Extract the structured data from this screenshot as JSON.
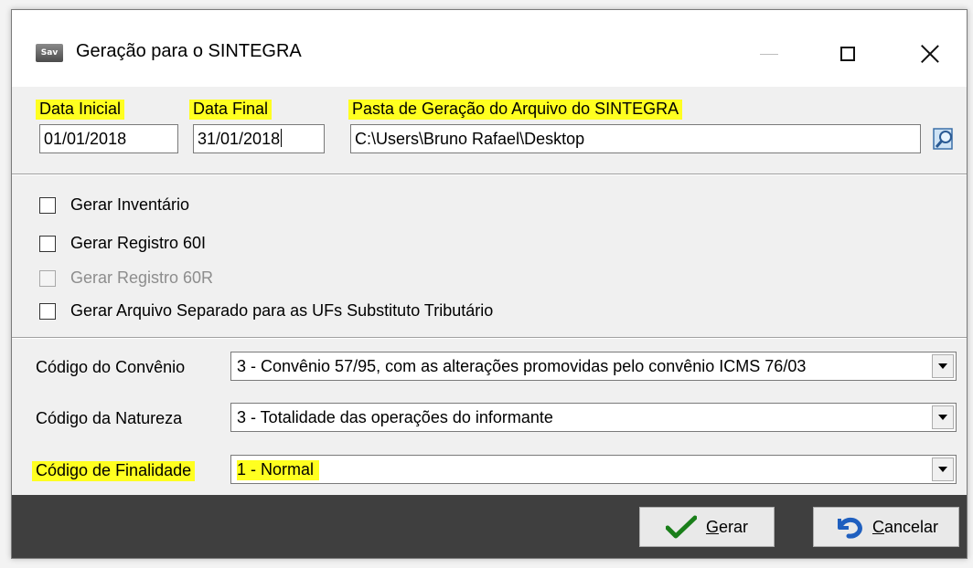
{
  "window": {
    "title": "Geração para o SINTEGRA",
    "icon_text": "Sav"
  },
  "dates": {
    "data_inicial_label": "Data Inicial",
    "data_inicial_value": "01/01/2018",
    "data_final_label": "Data Final",
    "data_final_value": "31/01/2018"
  },
  "folder": {
    "label": "Pasta de Geração do Arquivo do SINTEGRA",
    "value": "C:\\Users\\Bruno Rafael\\Desktop"
  },
  "options": [
    {
      "label": "Gerar Inventário",
      "checked": false,
      "enabled": true
    },
    {
      "label": "Gerar Registro 60I",
      "checked": false,
      "enabled": true
    },
    {
      "label": "Gerar Registro 60R",
      "checked": false,
      "enabled": false
    },
    {
      "label": "Gerar Arquivo Separado para as UFs Substituto Tributário",
      "checked": false,
      "enabled": true
    }
  ],
  "combos": {
    "convenio": {
      "label": "Código do Convênio",
      "value": "3 - Convênio 57/95, com as alterações promovidas pelo convênio ICMS 76/03"
    },
    "natureza": {
      "label": "Código da Natureza",
      "value": "3 - Totalidade das operações do informante"
    },
    "finalidade": {
      "label": "Código de Finalidade",
      "value": "1 - Normal"
    }
  },
  "buttons": {
    "gerar_first": "G",
    "gerar_rest": "erar",
    "cancelar_first": "C",
    "cancelar_rest": "ancelar"
  },
  "colors": {
    "highlight": "#ffff20",
    "footer": "#3f3f3f",
    "check_green": "#1a7f1a",
    "cancel_blue": "#1f5fbf"
  }
}
